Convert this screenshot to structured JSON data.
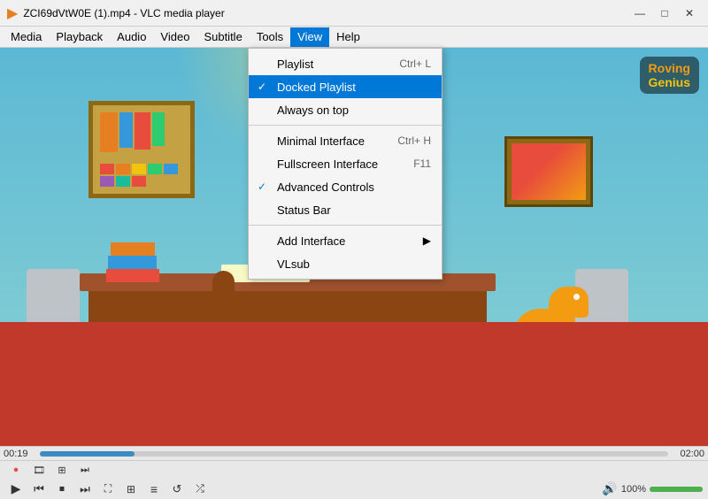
{
  "titlebar": {
    "title": "ZCI69dVtW0E (1).mp4 - VLC media player",
    "icon": "▶"
  },
  "window_controls": {
    "minimize": "—",
    "maximize": "□",
    "close": "✕"
  },
  "menubar": {
    "items": [
      "Media",
      "Playback",
      "Audio",
      "Video",
      "Subtitle",
      "Tools",
      "View",
      "Help"
    ]
  },
  "view_menu": {
    "items": [
      {
        "label": "Playlist",
        "shortcut": "Ctrl+L",
        "checked": false,
        "has_arrow": false,
        "separator_after": false
      },
      {
        "label": "Docked Playlist",
        "shortcut": "",
        "checked": true,
        "has_arrow": false,
        "separator_after": false
      },
      {
        "label": "Always on top",
        "shortcut": "",
        "checked": false,
        "has_arrow": false,
        "separator_after": true
      },
      {
        "label": "Minimal Interface",
        "shortcut": "Ctrl+H",
        "checked": false,
        "has_arrow": false,
        "separator_after": false
      },
      {
        "label": "Fullscreen Interface",
        "shortcut": "F11",
        "checked": false,
        "has_arrow": false,
        "separator_after": false
      },
      {
        "label": "Advanced Controls",
        "shortcut": "",
        "checked": true,
        "has_arrow": false,
        "separator_after": false
      },
      {
        "label": "Status Bar",
        "shortcut": "",
        "checked": false,
        "has_arrow": false,
        "separator_after": true
      },
      {
        "label": "Add Interface",
        "shortcut": "",
        "checked": false,
        "has_arrow": true,
        "separator_after": false
      },
      {
        "label": "VLsub",
        "shortcut": "",
        "checked": false,
        "has_arrow": false,
        "separator_after": false
      }
    ]
  },
  "playback": {
    "current_time": "00:19",
    "total_time": "02:00",
    "progress_percent": 15,
    "volume_percent": 100,
    "volume_label": "100%"
  },
  "logo": {
    "line1": "Roving",
    "line2": "Genius"
  },
  "controls": {
    "record": "⏺",
    "snapshot": "📷",
    "loop": "⟳",
    "next_frame": "⏭",
    "play": "▶",
    "prev": "⏮",
    "stop": "⏹",
    "next": "⏭",
    "fullscreen": "⛶",
    "extended": "⊞",
    "playlist_toggle": "≡",
    "loop2": "↺",
    "shuffle": "⤮",
    "volume_icon": "🔊"
  }
}
